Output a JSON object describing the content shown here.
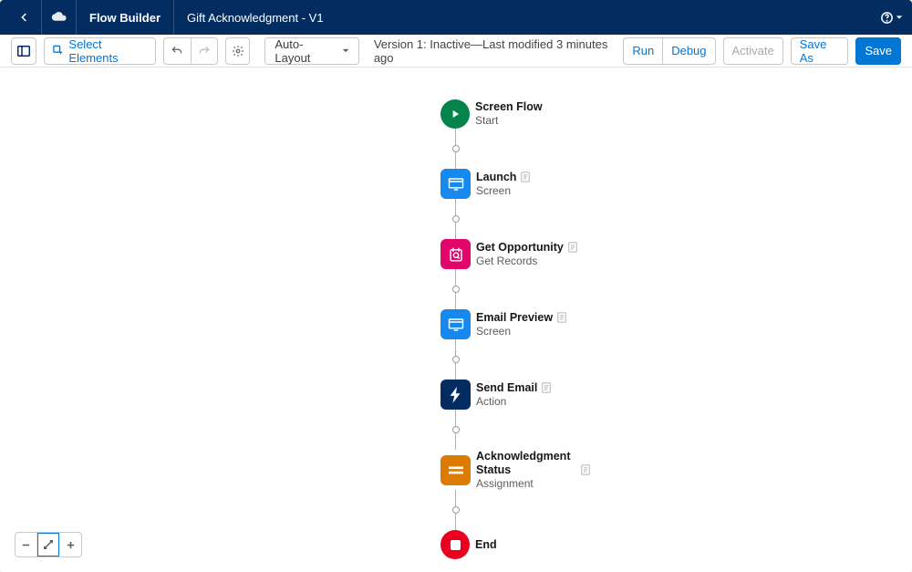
{
  "header": {
    "app_name": "Flow Builder",
    "flow_name": "Gift Acknowledgment - V1"
  },
  "toolbar": {
    "select_label": "Select Elements",
    "layout_mode": "Auto-Layout",
    "status": "Version 1: Inactive—Last modified 3 minutes ago",
    "run": "Run",
    "debug": "Debug",
    "activate": "Activate",
    "save_as": "Save As",
    "save": "Save"
  },
  "flow": {
    "nodes": [
      {
        "title": "Screen Flow",
        "subtitle": "Start"
      },
      {
        "title": "Launch",
        "subtitle": "Screen"
      },
      {
        "title": "Get Opportunity",
        "subtitle": "Get Records"
      },
      {
        "title": "Email Preview",
        "subtitle": "Screen"
      },
      {
        "title": "Send Email",
        "subtitle": "Action"
      },
      {
        "title": "Acknowledgment Status",
        "subtitle": "Assignment"
      },
      {
        "title": "End"
      }
    ]
  }
}
